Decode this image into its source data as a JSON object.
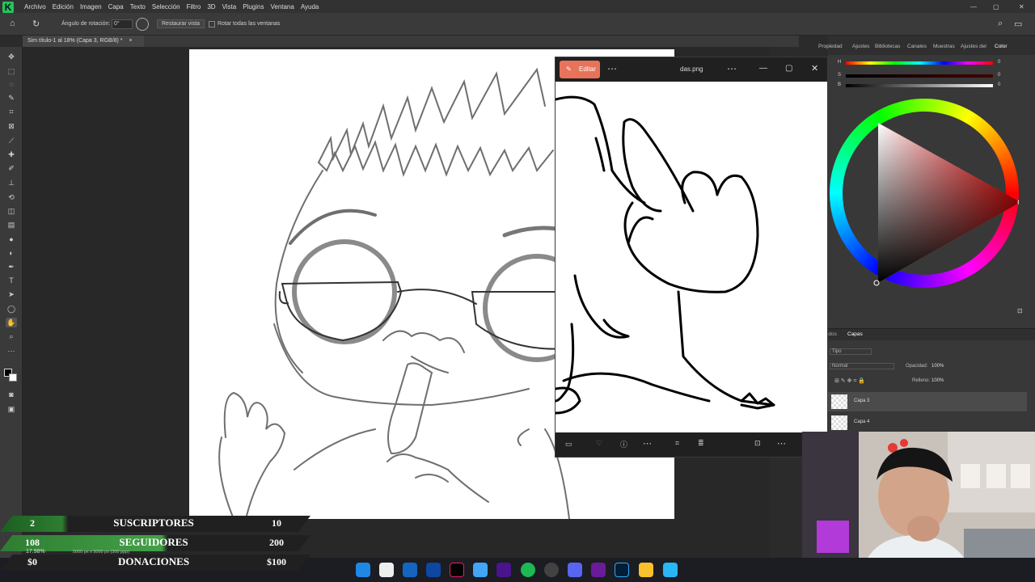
{
  "menubar": {
    "items": [
      "Archivo",
      "Edición",
      "Imagen",
      "Capa",
      "Texto",
      "Selección",
      "Filtro",
      "3D",
      "Vista",
      "Plugins",
      "Ventana",
      "Ayuda"
    ]
  },
  "options_bar": {
    "rotation_label": "Ángulo de rotación:",
    "rotation_value": "0°",
    "reset_view": "Restaurar vista",
    "rotate_all": "Rotar todas las ventanas"
  },
  "document": {
    "tab_title": "Sim título-1 al 18% (Capa 3, RGB/8) *",
    "zoom": "17.98%",
    "size_info": "5000 px x 5000 px (300 ppp)"
  },
  "right_panel": {
    "tabs": [
      "Propiedad",
      "Ajustes",
      "Bibliotecas",
      "Canales",
      "Muestras",
      "Ajustes del",
      "Color"
    ],
    "sliders": [
      {
        "label": "H",
        "value": "0"
      },
      {
        "label": "S",
        "value": "0"
      },
      {
        "label": "B",
        "value": "0"
      }
    ],
    "layers_tabs": [
      "Trazados",
      "Capas"
    ],
    "kind": "Tipo",
    "blend": "Normal",
    "opacity_label": "Opacidad:",
    "opacity_value": "100%",
    "fill_label": "Relleno:",
    "fill_value": "100%",
    "layers": [
      "Capa 3",
      "Capa 4"
    ]
  },
  "viewer": {
    "edit_button": "Editar",
    "filename": "das.png"
  },
  "stats": [
    {
      "left": "2",
      "label": "SUSCRIPTORES",
      "right": "10",
      "color": "#1b5e20"
    },
    {
      "left": "108",
      "label": "SEGUIDORES",
      "right": "200",
      "color": "#2e7d32"
    },
    {
      "left": "$0",
      "label": "DONACIONES",
      "right": "$100",
      "color": "#1b5e20"
    }
  ],
  "colors": {
    "accent": "#e8735a",
    "panel": "#383838",
    "stat_green": "#43a047"
  }
}
